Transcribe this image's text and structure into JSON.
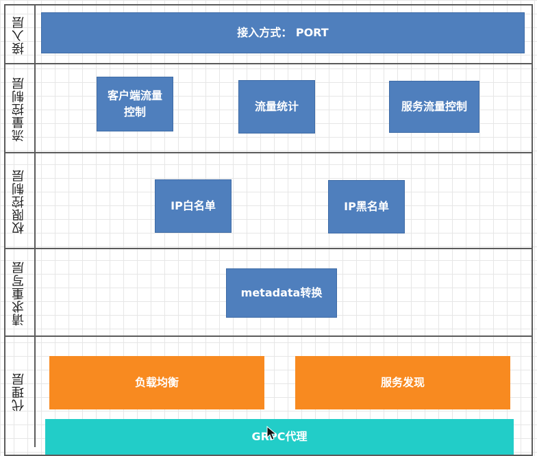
{
  "layers": [
    {
      "label": "接入层"
    },
    {
      "label": "流量控制层"
    },
    {
      "label": "权限控制层"
    },
    {
      "label": "请求重写层"
    },
    {
      "label": "代理层"
    }
  ],
  "access": {
    "port_box": "接入方式： PORT"
  },
  "flow": {
    "client_flow_control": "客户端流量\n控制",
    "flow_stats": "流量统计",
    "service_flow_control": "服务流量控制"
  },
  "auth": {
    "ip_whitelist": "IP白名单",
    "ip_blacklist": "IP黑名单"
  },
  "rewrite": {
    "metadata_transform": "metadata转换"
  },
  "proxy": {
    "load_balance": "负载均衡",
    "service_discovery": "服务发现",
    "grpc_proxy": "GRPC代理"
  },
  "colors": {
    "blue": "#4f7fbd",
    "orange": "#f88a20",
    "teal": "#22cdc8",
    "border": "#5a5a5a"
  }
}
